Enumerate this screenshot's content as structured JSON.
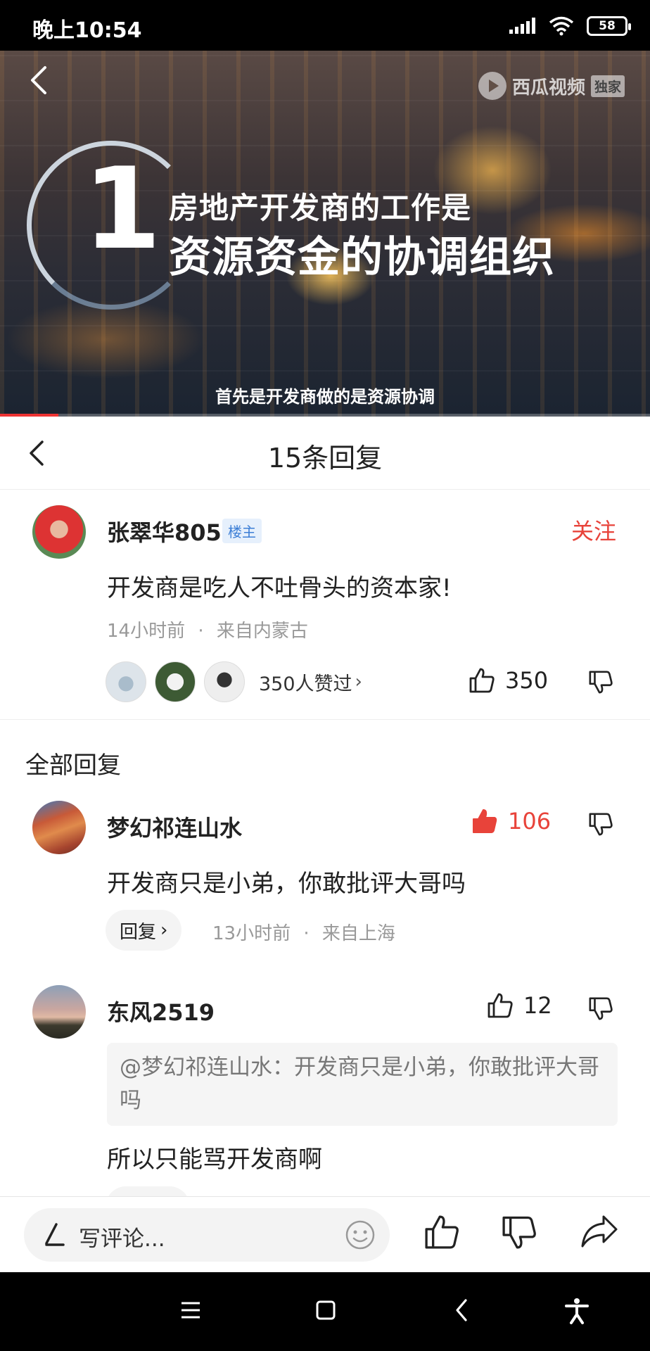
{
  "status_bar": {
    "time": "晚上10:54",
    "battery": "58"
  },
  "video": {
    "watermark": "西瓜视频",
    "watermark_tag": "独家",
    "number": "1",
    "headline_sub": "房地产开发商的工作是",
    "headline_main": "资源资金的协调组织",
    "subtitle": "首先是开发商做的是资源协调",
    "progress": 0.09
  },
  "header": {
    "title": "15条回复"
  },
  "main_comment": {
    "author": "张翠华805",
    "badge": "楼主",
    "follow_label": "关注",
    "text": "开发商是吃人不吐骨头的资本家!",
    "time": "14小时前",
    "location": "来自内蒙古",
    "liked_by": "350人赞过",
    "like_count": "350"
  },
  "replies_section": {
    "title": "全部回复"
  },
  "replies": [
    {
      "author": "梦幻祁连山水",
      "like_count": "106",
      "liked": true,
      "text": "开发商只是小弟，你敢批评大哥吗",
      "reply_label": "回复",
      "time": "13小时前",
      "location": "来自上海"
    },
    {
      "author": "东风2519",
      "like_count": "12",
      "liked": false,
      "quote": "@梦幻祁连山水：开发商只是小弟，你敢批评大哥吗",
      "text": "所以只能骂开发商啊"
    }
  ],
  "bottom_bar": {
    "placeholder": "写评论..."
  },
  "colors": {
    "accent_red": "#e8433a",
    "badge_blue": "#3d7fd6"
  },
  "icons": [
    "back-icon",
    "like-icon",
    "dislike-icon",
    "pen-icon",
    "emoji-icon",
    "share-icon",
    "menu-icon",
    "home-icon",
    "nav-back-icon",
    "accessibility-icon"
  ]
}
